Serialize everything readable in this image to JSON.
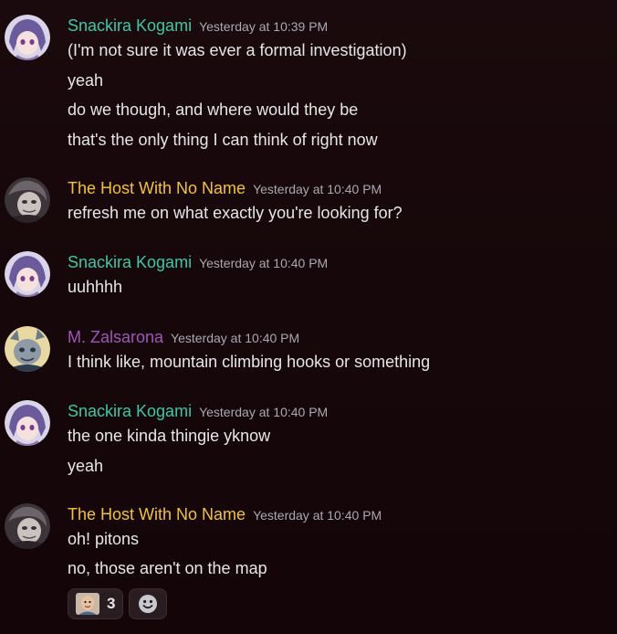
{
  "messages": [
    {
      "author": "Snackira Kogami",
      "timestamp": "Yesterday at 10:39 PM",
      "lines": [
        "(I'm not sure it was ever a formal investigation)",
        "yeah",
        "do we though, and where would they be",
        "that's the only thing I can think of right now"
      ]
    },
    {
      "author": "The Host With No Name",
      "timestamp": "Yesterday at 10:40 PM",
      "lines": [
        "refresh me on what exactly you're looking for?"
      ]
    },
    {
      "author": "Snackira Kogami",
      "timestamp": "Yesterday at 10:40 PM",
      "lines": [
        "uuhhhh"
      ]
    },
    {
      "author": "M. Zalsarona",
      "timestamp": "Yesterday at 10:40 PM",
      "lines": [
        "I think like, mountain climbing hooks or something"
      ]
    },
    {
      "author": "Snackira Kogami",
      "timestamp": "Yesterday at 10:40 PM",
      "lines": [
        "the one kinda thingie yknow",
        "yeah"
      ]
    },
    {
      "author": "The Host With No Name",
      "timestamp": "Yesterday at 10:40 PM",
      "lines": [
        "oh! pitons",
        "no, those aren't on the map"
      ]
    }
  ],
  "reactions": [
    {
      "emoji": "custom-face-emoji",
      "count": "3"
    },
    {
      "emoji": "add-reaction-icon"
    }
  ],
  "colors": {
    "snackira": "#3ec7a4",
    "host": "#f2c432",
    "zalsarona": "#9b59b6",
    "timestamp": "#a9a9b2"
  }
}
